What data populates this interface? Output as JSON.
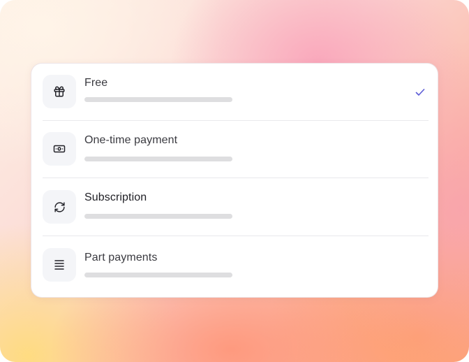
{
  "options": [
    {
      "label": "Free",
      "icon": "gift-icon",
      "selected": true
    },
    {
      "label": "One-time payment",
      "icon": "banknote-icon",
      "selected": false
    },
    {
      "label": "Subscription",
      "icon": "refresh-icon",
      "selected": false
    },
    {
      "label": "Part payments",
      "icon": "list-icon",
      "selected": false
    }
  ],
  "colors": {
    "accent": "#5b5bd6",
    "icon": "#222228",
    "icon_bg": "#f4f5f8",
    "placeholder_bar": "#dedee0"
  }
}
